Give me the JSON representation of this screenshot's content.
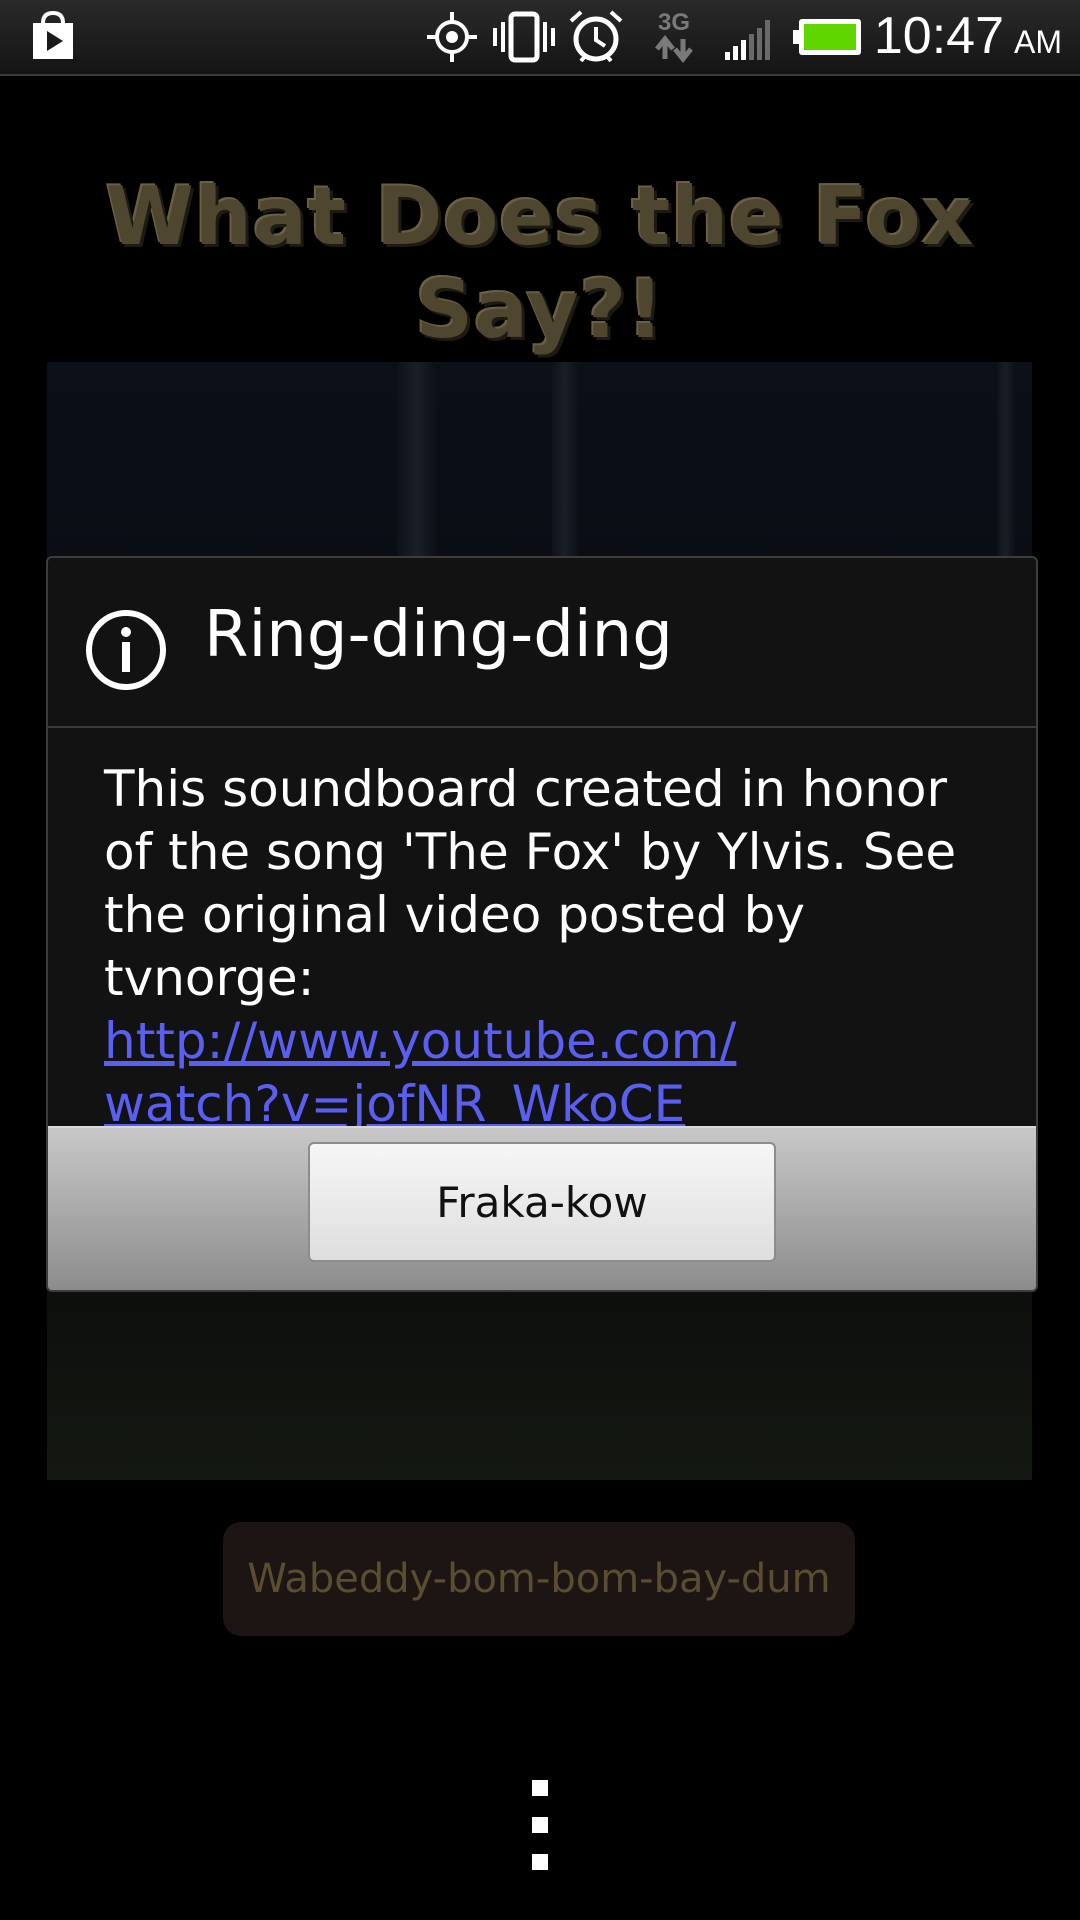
{
  "status_bar": {
    "time": "10:47",
    "ampm": "AM",
    "network": "3G",
    "icons": [
      "play-store-icon",
      "gps-icon",
      "vibrate-icon",
      "alarm-icon",
      "network-3g-icon",
      "signal-icon",
      "battery-icon"
    ],
    "battery_color": "#5fd600"
  },
  "app": {
    "title": "What Does the Fox Say?!",
    "sound_button_label": "Wabeddy-bom-bom-bay-dum",
    "title_color": "#4f4630"
  },
  "dialog": {
    "icon": "info-icon",
    "title": "Ring-ding-ding",
    "body": "This soundboard created in honor of the song 'The Fox' by Ylvis. See the original video posted by tvnorge:",
    "link_line1": "http://www.youtube.com/",
    "link_line2": "watch?v=jofNR_WkoCE",
    "button_label": "Fraka-kow",
    "link_color": "#5a5ff2"
  }
}
